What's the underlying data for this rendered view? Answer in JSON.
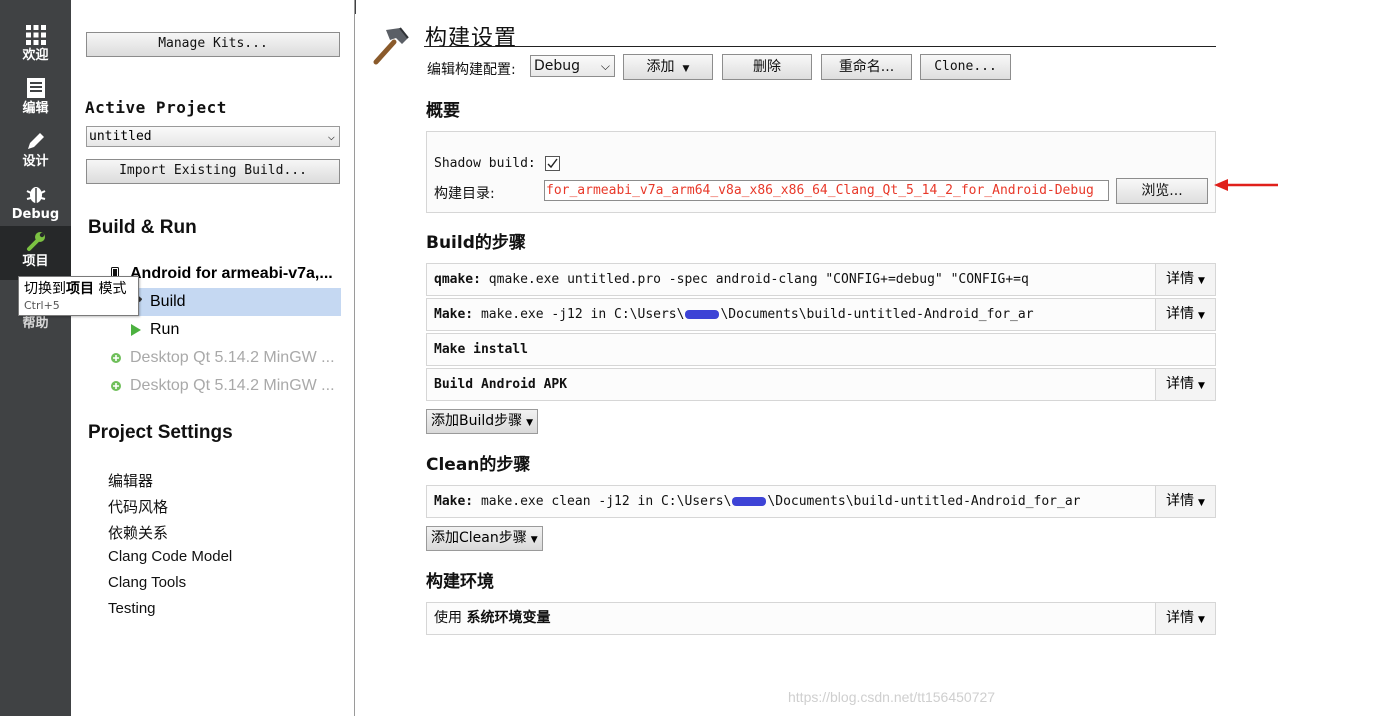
{
  "modes": [
    {
      "label": "欢迎",
      "icon": "grid-icon"
    },
    {
      "label": "编辑",
      "icon": "document-icon"
    },
    {
      "label": "设计",
      "icon": "pencil-icon"
    },
    {
      "label": "Debug",
      "icon": "bug-icon"
    },
    {
      "label": "项目",
      "icon": "wrench-icon"
    },
    {
      "label": "帮助",
      "icon": "help-icon"
    }
  ],
  "tooltip": {
    "prefix": "切换到",
    "bold": "项目",
    "suffix": " 模式",
    "shortcut": "Ctrl+5"
  },
  "nav": {
    "manage_kits": "Manage Kits...",
    "active_project_heading": "Active Project",
    "active_project_value": "untitled",
    "import_build": "Import Existing Build...",
    "build_run_heading": "Build & Run",
    "kit_active": "Android for armeabi-v7a,...",
    "build_item": "Build",
    "run_item": "Run",
    "kit_other_1": "Desktop Qt 5.14.2 MinGW ...",
    "kit_other_2": "Desktop Qt 5.14.2 MinGW ...",
    "project_settings_heading": "Project Settings",
    "settings_items": [
      "编辑器",
      "代码风格",
      "依赖关系",
      "Clang Code Model",
      "Clang Tools",
      "Testing"
    ]
  },
  "main": {
    "title": "构建设置",
    "edit_config_label": "编辑构建配置:",
    "config_value": "Debug",
    "add_button": "添加",
    "delete_button": "删除",
    "rename_button": "重命名...",
    "clone_button": "Clone...",
    "overview_heading": "概要",
    "shadow_build_label": "Shadow build:",
    "shadow_build_checked": true,
    "build_dir_label": "构建目录:",
    "build_dir_value": "for_armeabi_v7a_arm64_v8a_x86_x86_64_Clang_Qt_5_14_2_for_Android-Debug",
    "browse_button": "浏览...",
    "build_steps_heading": "Build的步骤",
    "build_steps": [
      {
        "name": "qmake:",
        "text": "qmake.exe untitled.pro -spec android-clang \"CONFIG+=debug\" \"CONFIG+=q",
        "details": "详情"
      },
      {
        "name": "Make:",
        "text_before": "make.exe -j12 in C:\\Users\\",
        "text_after": "\\Documents\\build-untitled-Android_for_ar",
        "details": "详情"
      },
      {
        "name": "Make install",
        "text": "",
        "details": ""
      },
      {
        "name": "Build Android APK",
        "text": "",
        "details": "详情"
      }
    ],
    "add_build_step": "添加Build步骤",
    "clean_steps_heading": "Clean的步骤",
    "clean_step": {
      "name": "Make:",
      "text_before": "make.exe clean -j12 in C:\\Users\\",
      "text_after": "\\Documents\\build-untitled-Android_for_ar",
      "details": "详情"
    },
    "add_clean_step": "添加Clean步骤",
    "env_heading": "构建环境",
    "env_prefix": "使用",
    "env_value": "系统环境变量",
    "env_details": "详情"
  },
  "watermark": "https://blog.csdn.net/tt156450727",
  "colors": {
    "modebar": "#404244",
    "modebar_active": "#262829",
    "selection": "#c5d8f2",
    "build_dir_text": "#e8392a",
    "annotation_arrow": "#e0201b",
    "redaction": "#3d43d6"
  }
}
